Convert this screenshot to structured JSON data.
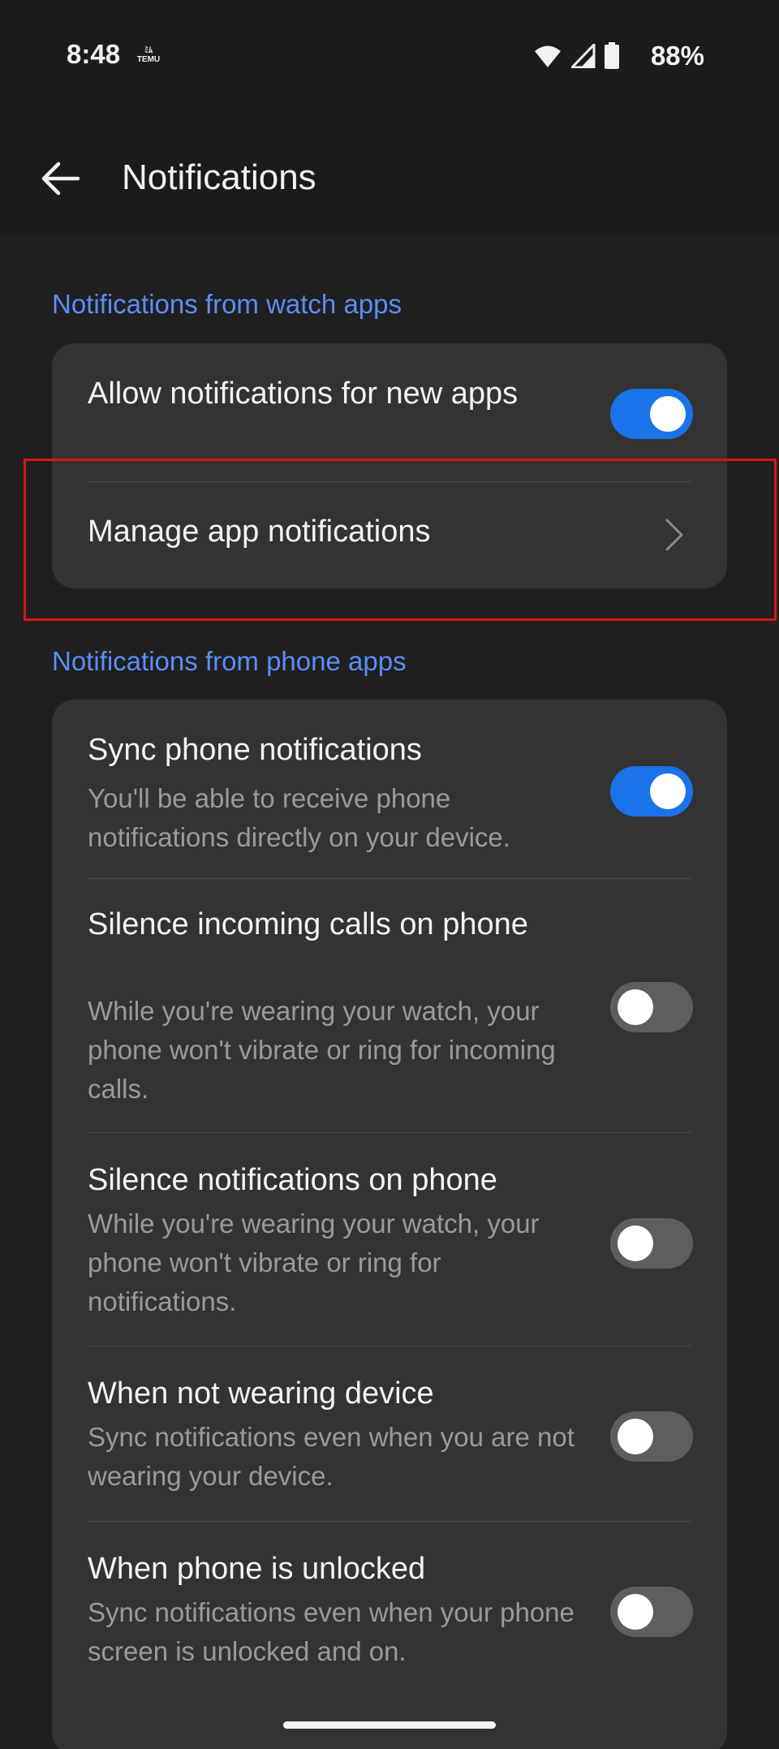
{
  "status_bar": {
    "time": "8:48",
    "app_icon_line1": "ﾐﾑ",
    "app_icon_line2": "TEMU",
    "battery_pct": "88%",
    "icons": [
      "wifi-icon",
      "signal-icon",
      "battery-icon"
    ]
  },
  "app_bar": {
    "title": "Notifications",
    "back_icon": "arrow-left-icon"
  },
  "watch_section": {
    "header": "Notifications from watch apps",
    "allow_new_apps": {
      "title": "Allow notifications for new apps",
      "enabled": true
    },
    "manage_app_notifications": {
      "title": "Manage app notifications"
    }
  },
  "phone_section": {
    "header": "Notifications from phone apps",
    "items": [
      {
        "title": "Sync phone notifications",
        "description": "You'll be able to receive phone notifications directly on your device.",
        "enabled": true
      },
      {
        "title": "Silence incoming calls on phone",
        "description": "While you're wearing your watch, your phone won't vibrate or ring for incoming calls.",
        "enabled": false
      },
      {
        "title": "Silence notifications on phone",
        "description": "While you're wearing your watch, your phone won't vibrate or ring for notifications.",
        "enabled": false
      },
      {
        "title": "When not wearing device",
        "description": "Sync notifications even when you are not wearing your device.",
        "enabled": false
      },
      {
        "title": "When phone is unlocked",
        "description": "Sync notifications even when your phone screen is unlocked and on.",
        "enabled": false
      }
    ]
  },
  "colors": {
    "accent": "#5b8ef9",
    "toggle_on": "#1a73e8",
    "toggle_off": "#5e5e5e",
    "card_bg": "#333333",
    "highlight": "#d8141b"
  }
}
